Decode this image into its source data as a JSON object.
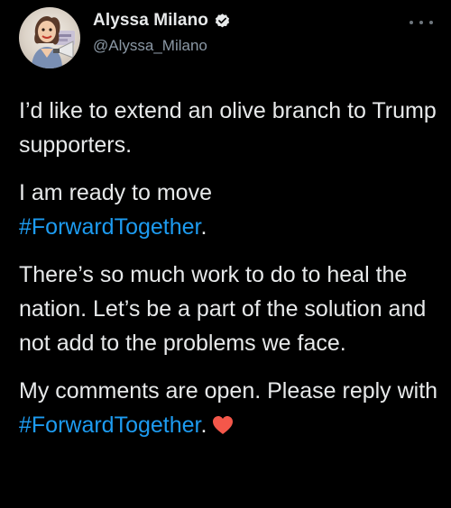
{
  "author": {
    "display_name": "Alyssa Milano",
    "handle": "@Alyssa_Milano",
    "verified": true,
    "avatar_icon": "caricature-avatar"
  },
  "menu": {
    "icon": "more-dots-icon"
  },
  "tweet": {
    "p1": "I’d like to extend an olive branch to Trump supporters.",
    "p2_text": "I am ready to move",
    "p2_hashtag": "#ForwardTogether",
    "p2_end": ".",
    "p3": "There’s so much work to do to heal the nation. Let’s be a part of the solution and not add to the problems we face.",
    "p4_text": "My comments are open. Please reply with",
    "p4_hashtag": "#ForwardTogether",
    "p4_end": ".",
    "emoji": "heart-icon"
  },
  "colors": {
    "background": "#000000",
    "text": "#e7e9ea",
    "secondary": "#8b98a5",
    "link": "#1d9bf0",
    "heart": "#f4574a"
  }
}
